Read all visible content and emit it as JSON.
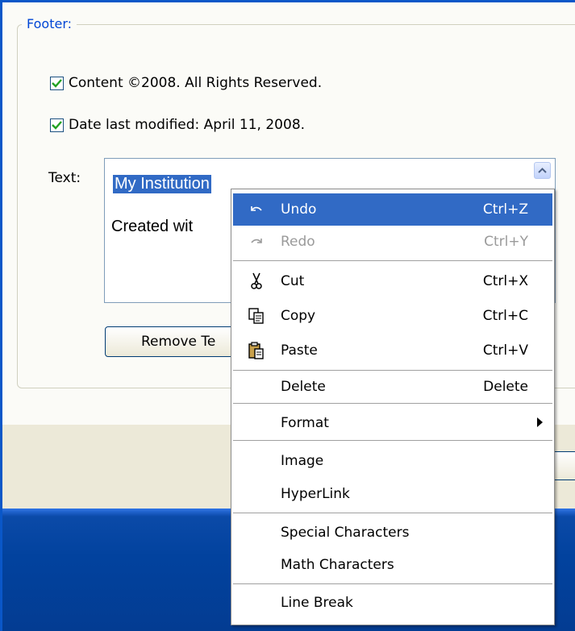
{
  "footer": {
    "legend": "Footer:",
    "content_check_label": "Content ©2008. All Rights Reserved.",
    "date_check_label": "Date last modified: April 11, 2008.",
    "text_label": "Text:",
    "text_line1": "My Institution",
    "text_line2": "Created wit",
    "remove_button_label": "Remove Te"
  },
  "context_menu": {
    "items": [
      {
        "label": "Undo",
        "shortcut": "Ctrl+Z",
        "icon": "undo-icon",
        "state": "highlighted"
      },
      {
        "label": "Redo",
        "shortcut": "Ctrl+Y",
        "icon": "redo-icon",
        "state": "disabled"
      },
      {
        "label": "Cut",
        "shortcut": "Ctrl+X",
        "icon": "scissors-icon"
      },
      {
        "label": "Copy",
        "shortcut": "Ctrl+C",
        "icon": "copy-icon"
      },
      {
        "label": "Paste",
        "shortcut": "Ctrl+V",
        "icon": "paste-icon"
      },
      {
        "label": "Delete",
        "shortcut": "Delete"
      },
      {
        "label": "Format",
        "icon": "submenu-arrow-icon"
      },
      {
        "label": "Image"
      },
      {
        "label": "HyperLink"
      },
      {
        "label": "Special Characters"
      },
      {
        "label": "Math Characters"
      },
      {
        "label": "Line Break"
      }
    ]
  },
  "colors": {
    "accent_blue": "#0046d5",
    "highlight": "#316ac5",
    "taskbar_blue": "#02429e",
    "checkbox_green": "#21a121"
  }
}
